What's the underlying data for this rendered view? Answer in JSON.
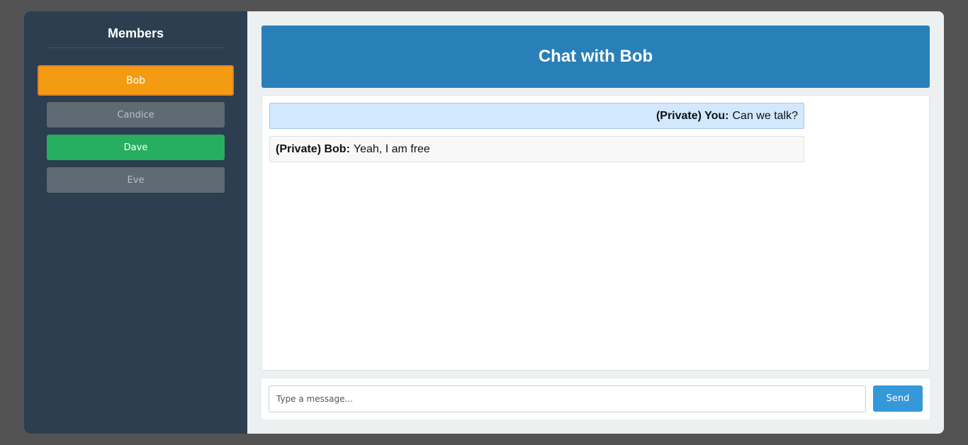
{
  "colors": {
    "sidebar_bg": "#2c3e50",
    "header_bg": "#2980b9",
    "send_bg": "#3498db",
    "member_active": "#f39c12",
    "member_online": "#27ae60",
    "member_offline": "#5f6a72"
  },
  "sidebar": {
    "title": "Members",
    "members": [
      {
        "name": "Bob",
        "status": "active"
      },
      {
        "name": "Candice",
        "status": "offline"
      },
      {
        "name": "Dave",
        "status": "online"
      },
      {
        "name": "Eve",
        "status": "offline"
      }
    ]
  },
  "chat": {
    "title": "Chat with Bob",
    "messages": [
      {
        "sender": "(Private) You:",
        "text": "Can we talk?",
        "mine": true
      },
      {
        "sender": "(Private) Bob:",
        "text": "Yeah, I am free",
        "mine": false
      }
    ]
  },
  "composer": {
    "placeholder": "Type a message...",
    "send_label": "Send"
  }
}
